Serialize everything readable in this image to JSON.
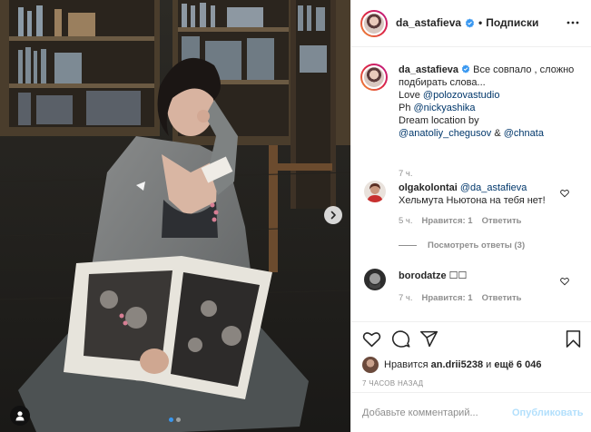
{
  "post": {
    "username": "da_astafieva",
    "dot": "•",
    "follow_label": "Подписки",
    "more_icon": "more-horizontal-icon"
  },
  "caption": {
    "username": "da_astafieva",
    "text_1": "Все совпало , сложно подбирать слова...",
    "love_prefix": "Love ",
    "love_mention": "@polozovastudio",
    "ph_prefix": "Ph ",
    "ph_mention": "@nickyashika",
    "dream": "Dream location by",
    "mention_a": "@anatoliy_chegusov",
    "amp": " & ",
    "mention_b": "@chnata",
    "time": "7 ч."
  },
  "comments": [
    {
      "username": "olgakolontai",
      "mention": "@da_astafieva",
      "text": "Хельмута Ньютона на тебя нет!",
      "time": "5 ч.",
      "likes": "Нравится: 1",
      "reply": "Ответить",
      "view_replies": "Посмотреть ответы (3)"
    },
    {
      "username": "borodatze",
      "text": "☐☐",
      "time": "7 ч.",
      "likes": "Нравится: 1",
      "reply": "Ответить"
    }
  ],
  "actions": {
    "likes_prefix": "Нравится ",
    "likes_user": "an.drii5238",
    "likes_mid": " и ",
    "likes_rest": "ещё 6 046",
    "time_ago": "7 часов назад"
  },
  "add_comment": {
    "placeholder": "Добавьте комментарий...",
    "post_label": "Опубликовать"
  },
  "colors": {
    "accent": "#3897f0",
    "mention": "#00376b",
    "muted": "#8e8e8e",
    "post_disabled": "#b2dffc"
  }
}
